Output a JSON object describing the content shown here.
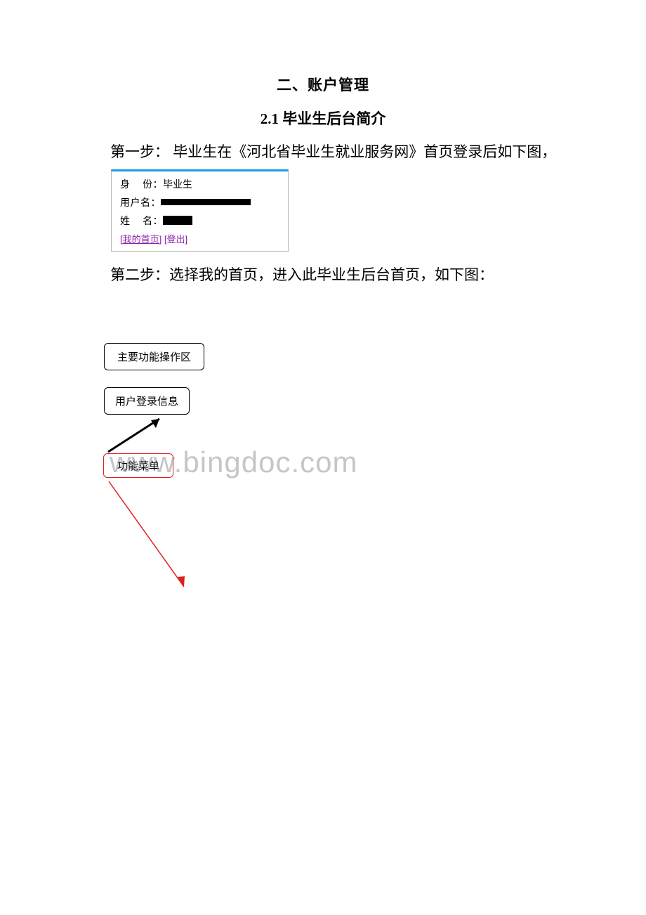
{
  "headings": {
    "h1": "二、账户管理",
    "h2_num": "2.1",
    "h2_text": " 毕业生后台简介"
  },
  "paragraphs": {
    "p1": "第一步： 毕业生在《河北省毕业生就业服务网》首页登录后如下图，",
    "p2": "第二步：选择我的首页，进入此毕业生后台首页，如下图："
  },
  "screenshot": {
    "identity_label": "身",
    "identity_label2": "份：",
    "identity_value": "毕业生",
    "username_label": "用户名：",
    "name_label": "姓",
    "name_label2": "名：",
    "link_home": "[我的首页]",
    "link_logout": "[登出]"
  },
  "boxes": {
    "main_ops": "主要功能操作区",
    "login_info": "用户登录信息",
    "menu": "功能菜单"
  },
  "watermark": "www.bingdoc.com"
}
